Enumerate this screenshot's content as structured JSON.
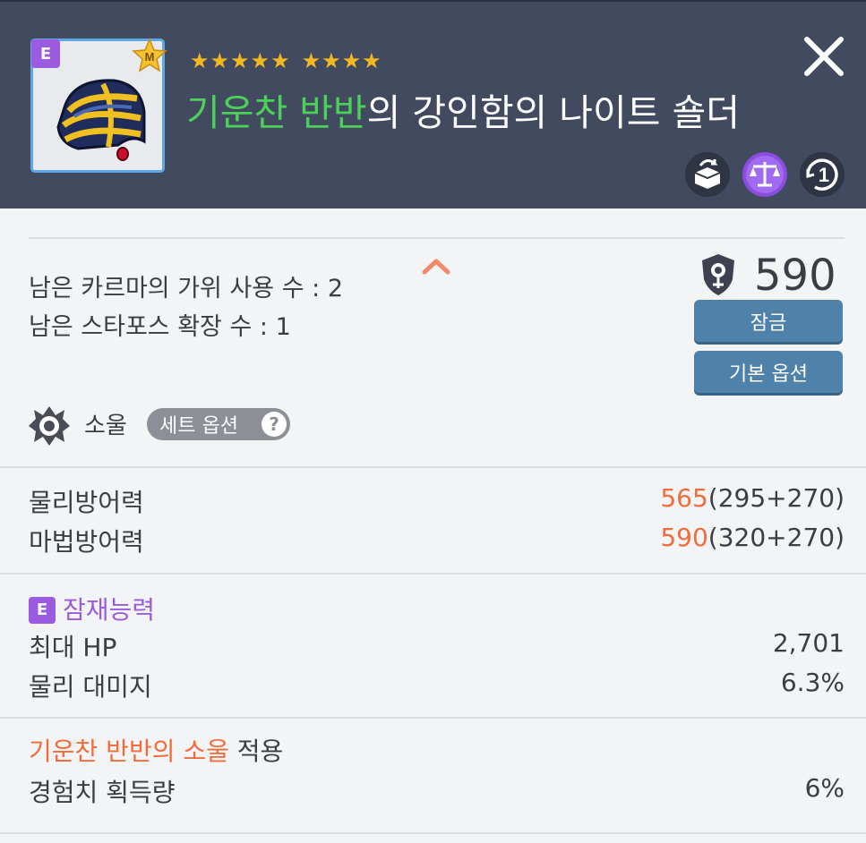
{
  "header": {
    "grade_badge": "E",
    "mastery_badge": "M",
    "stars_group1": "★★★★★",
    "stars_group2": "★★★★",
    "title_prefix": "기운찬 반반",
    "title_rest": "의 강인함의 나이트 숄더",
    "icons": [
      "transfer-icon",
      "balance-scale-icon",
      "one-upgrade-icon"
    ],
    "close_icon": "close-icon"
  },
  "info": {
    "karma_label": "남은 카르마의 가위 사용 수 :",
    "karma_value": "2",
    "starforce_label": "남은 스타포스 확장 수 :",
    "starforce_value": "1",
    "combat_power": "590",
    "lock_button": "잠금",
    "base_option_button": "기본 옵션"
  },
  "soul": {
    "label": "소울",
    "set_option": "세트 옵션",
    "help": "?"
  },
  "defense": [
    {
      "label": "물리방어력",
      "total": "565",
      "breakdown": "(295+270)"
    },
    {
      "label": "마법방어력",
      "total": "590",
      "breakdown": "(320+270)"
    }
  ],
  "potential": {
    "badge": "E",
    "title": "잠재능력",
    "lines": [
      {
        "label": "최대 HP",
        "value": "2,701"
      },
      {
        "label": "물리 대미지",
        "value": "6.3%"
      }
    ]
  },
  "soul_effect": {
    "name": "기운찬 반반의 소울",
    "suffix": "적용",
    "line": {
      "label": "경험치 획득량",
      "value": "6%"
    }
  },
  "colors": {
    "header_bg": "#414a5f",
    "accent_green": "#4cd05a",
    "accent_orange": "#f26c3b",
    "accent_purple": "#9a5be0",
    "button_blue": "#4f82aa",
    "star_gold": "#f2b820"
  }
}
